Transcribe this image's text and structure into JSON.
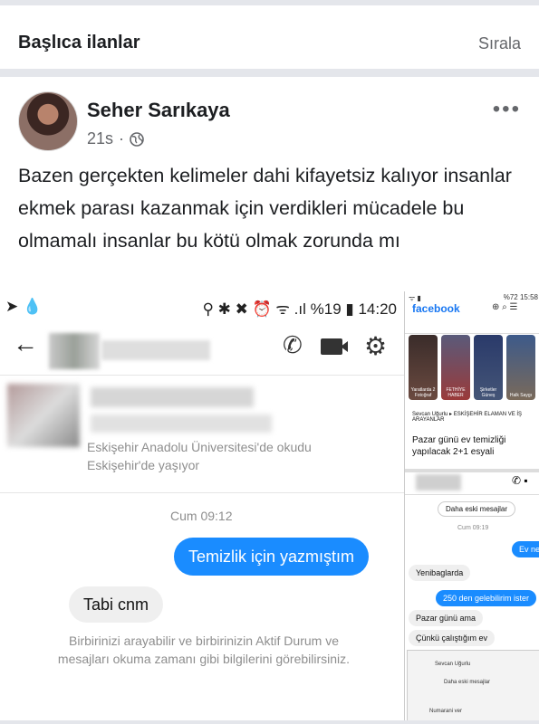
{
  "section": {
    "title": "Başlıca ilanlar",
    "sort_label": "Sırala"
  },
  "post": {
    "author": "Seher Sarıkaya",
    "time": "21s",
    "meta_sep": "·",
    "more": "•••",
    "text": "Bazen gerçekten kelimeler dahi kifayetsiz kalıyor insanlar ekmek parası kazanmak için verdikleri mücadele bu olmamalı insanlar bu kötü olmak zorunda mı"
  },
  "screenshot_left": {
    "status_left": "➤ 💧",
    "status_right": "⚲ ✱ ✖ ⏰ ᯤ .ıl %19 ▮ 14:20",
    "profile_line1": "Eskişehir Anadolu Üniversitesi'de okudu",
    "profile_line2": "Eskişehir'de yaşıyor",
    "time": "Cum 09:12",
    "outgoing": "Temizlik için yazmıştım",
    "incoming": "Tabi cnm",
    "notice": "Birbirinizi arayabilir ve birbirinizin Aktif Durum ve mesajları okuma zamanı gibi bilgilerini görebilirsiniz."
  },
  "screenshot_right": {
    "status_left": "ᯤ ▮",
    "status_right": "%72 15:58",
    "app_name": "facebook",
    "stories": [
      "Yaratlarda 2 Fotoğraf",
      "FETHİYE HABER",
      "Şirketler Güneş",
      "Halk Saygı"
    ],
    "group_name": "Sevcan Uğurlu ▸ ESKİŞEHİR ELAMAN VE İŞ ARAYANLAR",
    "post_text": "Pazar günü ev temizliği yapılacak 2+1 esyali",
    "older_messages": "Daha eski mesajlar",
    "time": "Cum 09:19",
    "msg_out_1": "Ev ne",
    "msg_in_1": "Yenibaglarda",
    "msg_out_2": "250 den gelebilirim ister",
    "msg_in_2": "Pazar günü ama",
    "msg_in_3": "Çünkü çalıştığım ev",
    "mini_name": "Sevcan Uğurlu",
    "mini_older": "Daha eski mesajlar",
    "mini_msg": "Numarani ver"
  },
  "colors": {
    "messenger_blue": "#1a8cff",
    "facebook_blue": "#1877f2",
    "divider": "#e4e6eb"
  }
}
